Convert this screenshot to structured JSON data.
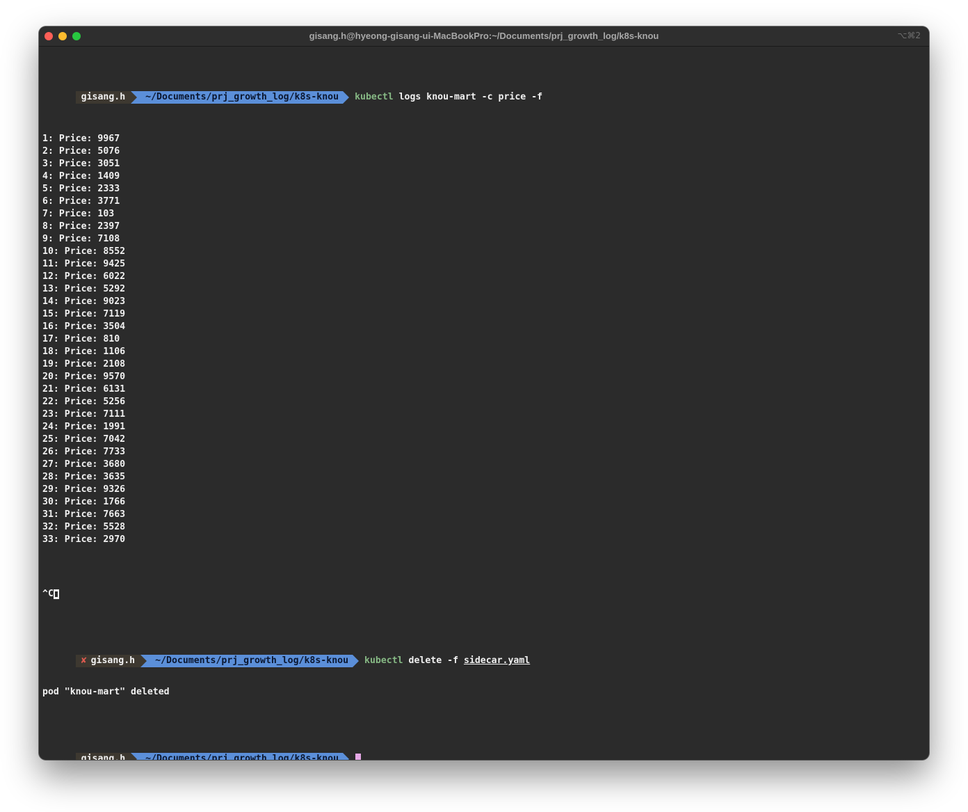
{
  "window": {
    "title": "gisang.h@hyeong-gisang-ui-MacBookPro:~/Documents/prj_growth_log/k8s-knou",
    "shortcut": "⌥⌘2"
  },
  "prompt": {
    "user": "gisang.h",
    "path": "~/Documents/prj_growth_log/k8s-knou",
    "error_mark": "✘"
  },
  "commands": {
    "first": {
      "name": "kubectl",
      "args": "logs knou-mart -c price -f"
    },
    "second": {
      "name": "kubectl",
      "args": "delete -f ",
      "file": "sidecar.yaml"
    }
  },
  "log_lines": [
    "1: Price: 9967",
    "2: Price: 5076",
    "3: Price: 3051",
    "4: Price: 1409",
    "5: Price: 2333",
    "6: Price: 3771",
    "7: Price: 103",
    "8: Price: 2397",
    "9: Price: 7108",
    "10: Price: 8552",
    "11: Price: 9425",
    "12: Price: 6022",
    "13: Price: 5292",
    "14: Price: 9023",
    "15: Price: 7119",
    "16: Price: 3504",
    "17: Price: 810",
    "18: Price: 1106",
    "19: Price: 2108",
    "20: Price: 9570",
    "21: Price: 6131",
    "22: Price: 5256",
    "23: Price: 7111",
    "24: Price: 1991",
    "25: Price: 7042",
    "26: Price: 7733",
    "27: Price: 3680",
    "28: Price: 3635",
    "29: Price: 9326",
    "30: Price: 1766",
    "31: Price: 7663",
    "32: Price: 5528",
    "33: Price: 2970"
  ],
  "interrupt": "^C",
  "delete_output": "pod \"knou-mart\" deleted",
  "colors": {
    "background": "#2b2b2b",
    "user_segment": "#3d3830",
    "path_segment": "#5b8fd9",
    "command": "#86b884",
    "error": "#e05a50",
    "cursor": "#e6a8e6"
  }
}
